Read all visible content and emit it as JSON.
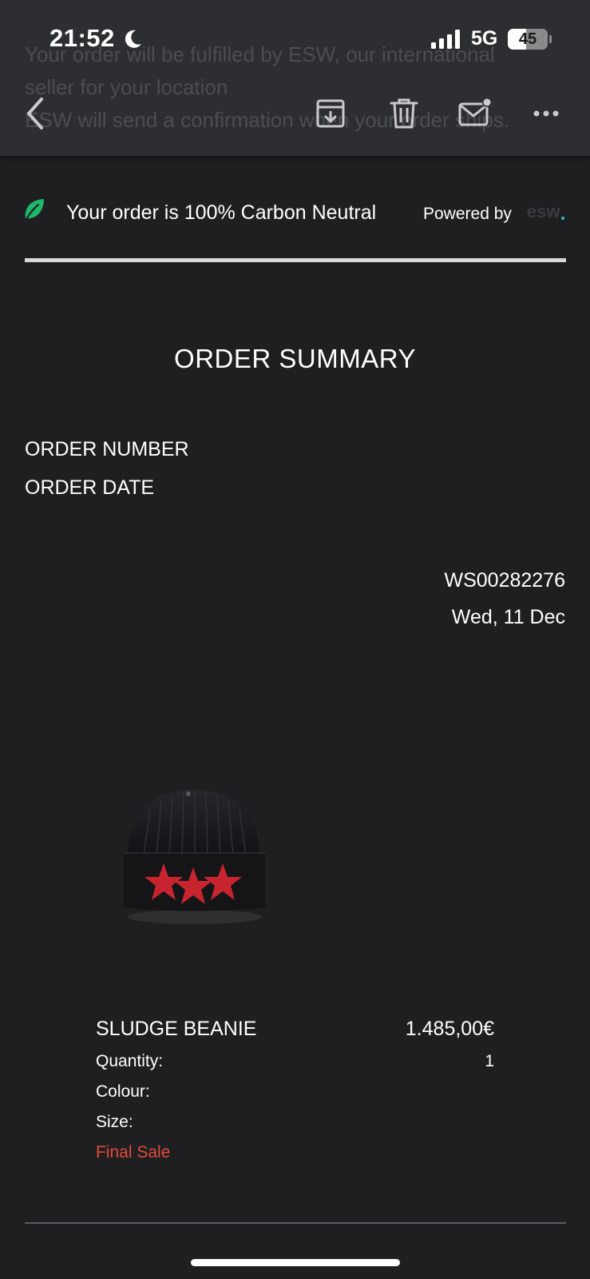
{
  "status_bar": {
    "time": "21:52",
    "network": "5G",
    "battery": "45",
    "battery_level_percent": 45
  },
  "ghost_text": {
    "line1": "Your order will be fulfilled by ESW, our international",
    "line2": "seller for your location",
    "line3": "ESW will send a confirmation when your order ships."
  },
  "toolbar": {
    "icons": [
      "back-icon",
      "archive-icon",
      "trash-icon",
      "mail-icon",
      "more-icon"
    ]
  },
  "carbon": {
    "text": "Your order is 100% Carbon Neutral",
    "powered_by": "Powered by",
    "brand": "esw",
    "leaf_color": "#1db86a"
  },
  "summary": {
    "title": "ORDER SUMMARY",
    "order_number_label": "ORDER NUMBER",
    "order_date_label": "ORDER DATE",
    "order_number": "WS00282276",
    "order_date": "Wed, 11 Dec"
  },
  "product": {
    "name": "SLUDGE BEANIE",
    "price": "1.485,00€",
    "quantity_label": "Quantity:",
    "quantity": "1",
    "colour_label": "Colour:",
    "size_label": "Size:",
    "final_sale": "Final Sale",
    "final_sale_color": "#e14a3b"
  }
}
